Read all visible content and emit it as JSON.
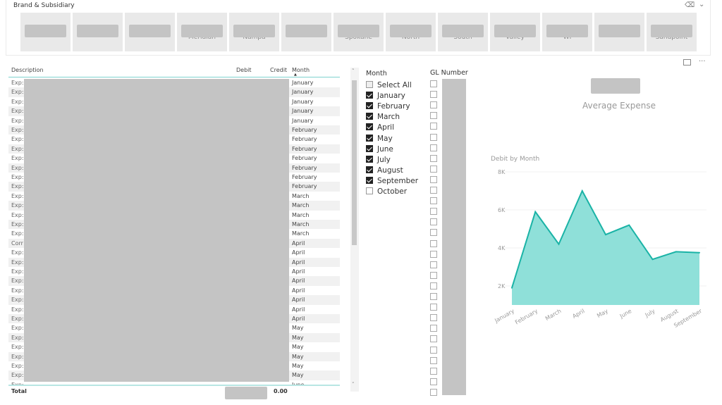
{
  "slicer": {
    "title": "Brand & Subsidiary",
    "tiles": [
      "",
      "",
      "",
      "Meridian",
      "Nampa",
      "",
      "Spokane",
      "North",
      "South",
      "Valley",
      "WI",
      "",
      "Sandpoint"
    ]
  },
  "table": {
    "headers": {
      "description": "Description",
      "debit": "Debit",
      "credit": "Credit",
      "month": "Month"
    },
    "rows": [
      {
        "d": "Exp:",
        "m": "January"
      },
      {
        "d": "Exp:",
        "m": "January"
      },
      {
        "d": "Exp:",
        "m": "January"
      },
      {
        "d": "Exp:",
        "m": "January"
      },
      {
        "d": "Exp:",
        "m": "January"
      },
      {
        "d": "Exp:",
        "m": "February"
      },
      {
        "d": "Exp:",
        "m": "February"
      },
      {
        "d": "Exp:",
        "m": "February"
      },
      {
        "d": "Exp:",
        "m": "February"
      },
      {
        "d": "Exp:",
        "m": "February"
      },
      {
        "d": "Exp:",
        "m": "February"
      },
      {
        "d": "Exp:",
        "m": "February"
      },
      {
        "d": "Exp:",
        "m": "March"
      },
      {
        "d": "Exp:",
        "m": "March"
      },
      {
        "d": "Exp:",
        "m": "March"
      },
      {
        "d": "Exp:",
        "m": "March"
      },
      {
        "d": "Exp:",
        "m": "March"
      },
      {
        "d": "Corr",
        "m": "April"
      },
      {
        "d": "Exp:",
        "m": "April"
      },
      {
        "d": "Exp:",
        "m": "April"
      },
      {
        "d": "Exp:",
        "m": "April"
      },
      {
        "d": "Exp:",
        "m": "April"
      },
      {
        "d": "Exp:",
        "m": "April"
      },
      {
        "d": "Exp:",
        "m": "April"
      },
      {
        "d": "Exp:",
        "m": "April"
      },
      {
        "d": "Exp:",
        "m": "April"
      },
      {
        "d": "Exp:",
        "m": "May"
      },
      {
        "d": "Exp:",
        "m": "May"
      },
      {
        "d": "Exp:",
        "m": "May"
      },
      {
        "d": "Exp:",
        "m": "May"
      },
      {
        "d": "Exp:",
        "m": "May"
      },
      {
        "d": "Exp:",
        "m": "May"
      },
      {
        "d": "Exp:",
        "m": "June"
      }
    ],
    "total_label": "Total",
    "total_credit": "0.00"
  },
  "month_slicer": {
    "title": "Month",
    "items": [
      {
        "label": "Select All",
        "state": "partial"
      },
      {
        "label": "January",
        "checked": true
      },
      {
        "label": "February",
        "checked": true
      },
      {
        "label": "March",
        "checked": true
      },
      {
        "label": "April",
        "checked": true
      },
      {
        "label": "May",
        "checked": true
      },
      {
        "label": "June",
        "checked": true
      },
      {
        "label": "July",
        "checked": true
      },
      {
        "label": "August",
        "checked": true
      },
      {
        "label": "September",
        "checked": true
      },
      {
        "label": "October",
        "checked": false
      }
    ]
  },
  "gl_slicer": {
    "title": "GL Number"
  },
  "card": {
    "label": "Average Expense"
  },
  "chart_data": {
    "type": "area",
    "title": "Debit  by Month",
    "categories": [
      "January",
      "February",
      "March",
      "April",
      "May",
      "June",
      "July",
      "August",
      "September"
    ],
    "values": [
      1900,
      5900,
      4200,
      7000,
      4700,
      5200,
      3400,
      3800,
      3750
    ],
    "yticks": [
      "2K",
      "4K",
      "6K",
      "8K"
    ],
    "ylim": [
      1000,
      8000
    ],
    "grid": true,
    "color": "#1ab3a6",
    "fill": "#8fe0d9"
  }
}
